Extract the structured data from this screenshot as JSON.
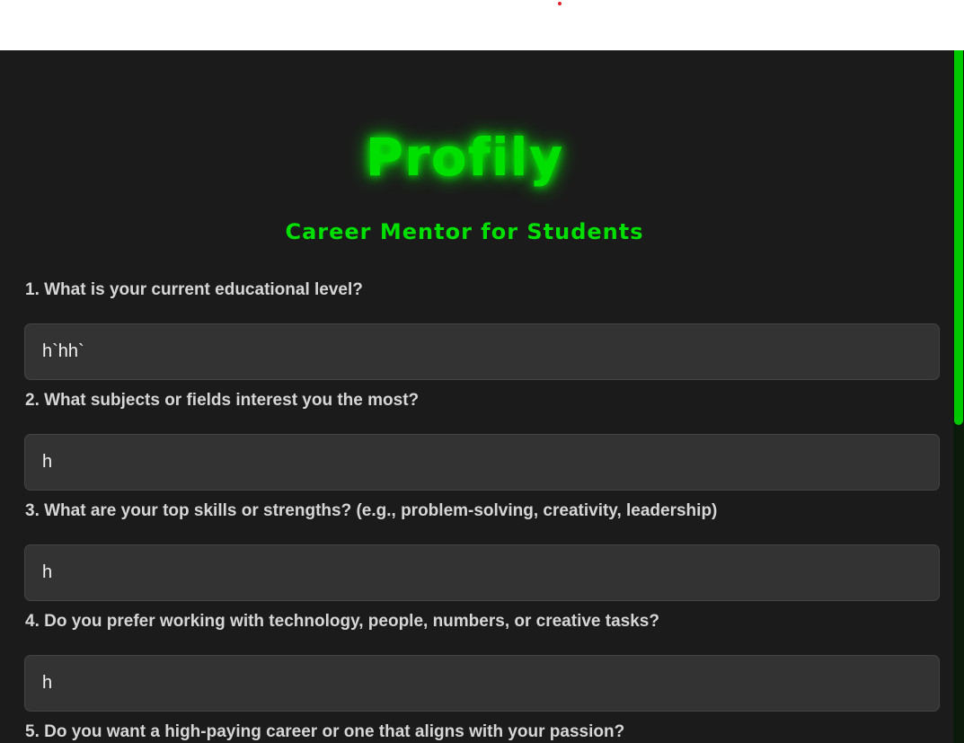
{
  "colors": {
    "accent": "#00e000",
    "glow": "#00ff00",
    "scrollbar": "#00c800",
    "marker": "#e0202a"
  },
  "header": {
    "logo": "Profily",
    "subtitle": "Career Mentor for Students"
  },
  "questions": [
    {
      "label": "1. What is your current educational level?",
      "value": "h`hh`"
    },
    {
      "label": "2. What subjects or fields interest you the most?",
      "value": "h"
    },
    {
      "label": "3. What are your top skills or strengths? (e.g., problem-solving, creativity, leadership)",
      "value": "h"
    },
    {
      "label": "4. Do you prefer working with technology, people, numbers, or creative tasks?",
      "value": "h"
    },
    {
      "label": "5. Do you want a high-paying career or one that aligns with your passion?",
      "value": ""
    }
  ]
}
